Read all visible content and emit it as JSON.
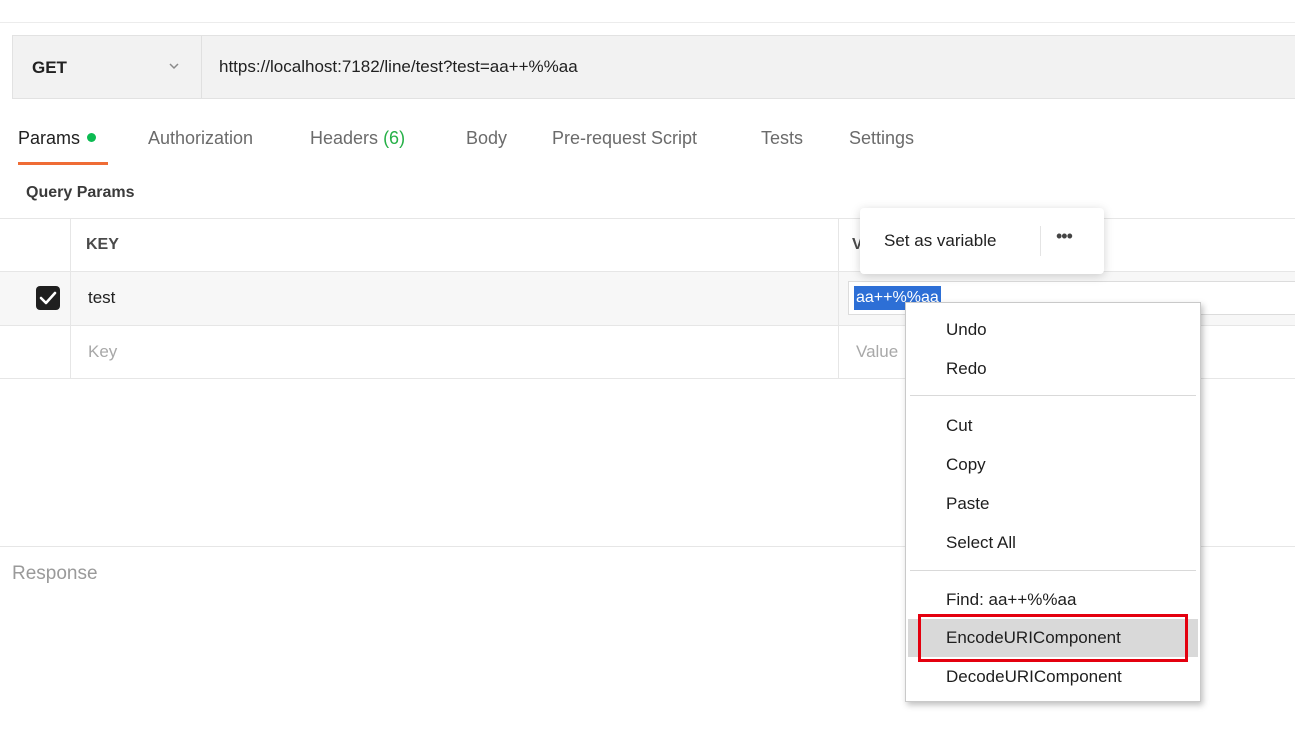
{
  "request": {
    "method": "GET",
    "url": "https://localhost:7182/line/test?test=aa++%%aa"
  },
  "tabs": [
    {
      "label": "Params",
      "active": true
    },
    {
      "label": "Authorization"
    },
    {
      "label": "Headers",
      "count": "(6)"
    },
    {
      "label": "Body"
    },
    {
      "label": "Pre-request Script"
    },
    {
      "label": "Tests"
    },
    {
      "label": "Settings"
    }
  ],
  "query_params": {
    "title": "Query Params",
    "columns": {
      "key": "KEY",
      "value": "V"
    },
    "rows": [
      {
        "checked": true,
        "key": "test",
        "value": "aa++%%aa"
      }
    ],
    "placeholder": {
      "key": "Key",
      "value": "Value"
    }
  },
  "popover": {
    "label": "Set as variable",
    "more": "•••"
  },
  "context_menu": {
    "items": [
      {
        "label": "Undo"
      },
      {
        "label": "Redo"
      },
      {
        "label": "Cut"
      },
      {
        "label": "Copy"
      },
      {
        "label": "Paste"
      },
      {
        "label": "Select All"
      },
      {
        "label": "Find: aa++%%aa"
      },
      {
        "label": "EncodeURIComponent",
        "highlighted": true
      },
      {
        "label": "DecodeURIComponent"
      }
    ]
  },
  "response": {
    "label": "Response"
  },
  "colors": {
    "active_tab_underline": "#ef6c35",
    "params_dot": "#0cbb52",
    "selection": "#2d6fd6",
    "annotation_box": "#e4000f"
  }
}
